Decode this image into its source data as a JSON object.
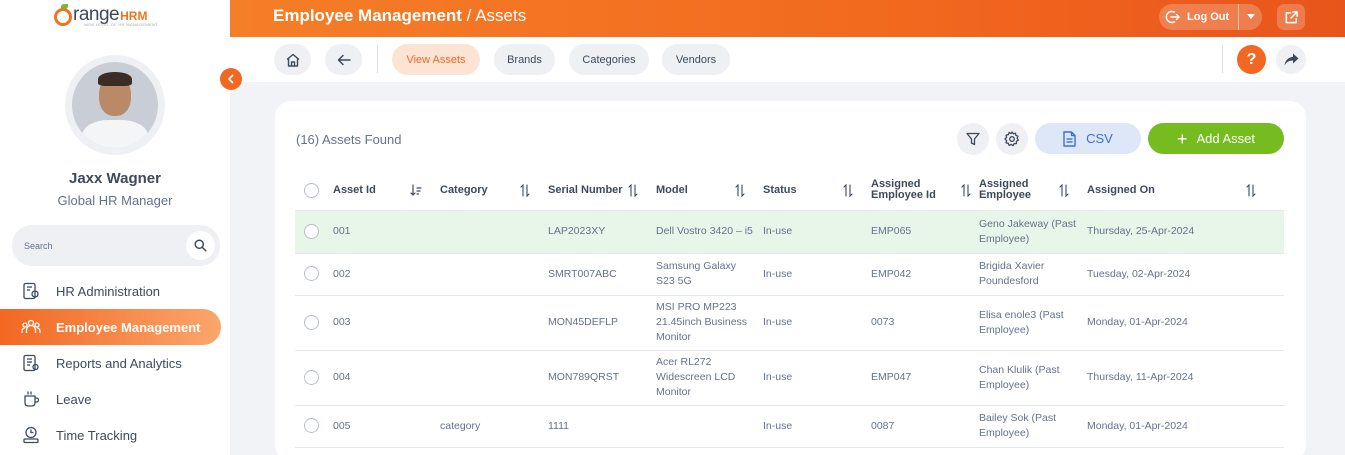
{
  "brand": {
    "name": "range",
    "suffix": "HRM",
    "tagline": "NEW LEVEL OF HR MANAGEMENT"
  },
  "user": {
    "name": "Jaxx Wagner",
    "role": "Global HR Manager"
  },
  "sidebar": {
    "search_placeholder": "Search",
    "items": [
      {
        "label": "HR Administration",
        "icon": "hr-admin-icon"
      },
      {
        "label": "Employee Management",
        "icon": "employee-management-icon",
        "active": true
      },
      {
        "label": "Reports and Analytics",
        "icon": "reports-icon"
      },
      {
        "label": "Leave",
        "icon": "leave-icon"
      },
      {
        "label": "Time Tracking",
        "icon": "time-tracking-icon"
      }
    ]
  },
  "header": {
    "title": "Employee Management",
    "separator": " / ",
    "subtitle": "Assets",
    "logout_label": "Log Out"
  },
  "subnav": {
    "tabs": [
      {
        "label": "View Assets",
        "active": true
      },
      {
        "label": "Brands"
      },
      {
        "label": "Categories"
      },
      {
        "label": "Vendors"
      }
    ],
    "help_label": "?"
  },
  "assets": {
    "found_text": "(16) Assets Found",
    "csv_label": "CSV",
    "add_label": "Add Asset",
    "columns": [
      "Asset Id",
      "Category",
      "Serial Number",
      "Model",
      "Status",
      "Assigned Employee Id",
      "Assigned Employee",
      "Assigned On"
    ],
    "rows": [
      {
        "id": "001",
        "category": "",
        "serial": "LAP2023XY",
        "model": "Dell Vostro 3420 – i5",
        "status": "In-use",
        "emp_id": "EMP065",
        "employee": "Geno Jakeway (Past Employee)",
        "assigned_on": "Thursday, 25-Apr-2024"
      },
      {
        "id": "002",
        "category": "",
        "serial": "SMRT007ABC",
        "model": "Samsung Galaxy S23 5G",
        "status": "In-use",
        "emp_id": "EMP042",
        "employee": "Brigida Xavier Poundesford",
        "assigned_on": "Tuesday, 02-Apr-2024"
      },
      {
        "id": "003",
        "category": "",
        "serial": "MON45DEFLP",
        "model": "MSI PRO MP223 21.45inch Business Monitor",
        "status": "In-use",
        "emp_id": "0073",
        "employee": "Elisa enole3 (Past Employee)",
        "assigned_on": "Monday, 01-Apr-2024"
      },
      {
        "id": "004",
        "category": "",
        "serial": "MON789QRST",
        "model": "Acer RL272 Widescreen LCD Monitor",
        "status": "In-use",
        "emp_id": "EMP047",
        "employee": "Chan Klulik (Past Employee)",
        "assigned_on": "Thursday, 11-Apr-2024"
      },
      {
        "id": "005",
        "category": "category",
        "serial": "1111",
        "model": "",
        "status": "In-use",
        "emp_id": "0087",
        "employee": "Bailey Sok (Past Employee)",
        "assigned_on": "Monday, 01-Apr-2024"
      }
    ]
  },
  "colors": {
    "accent": "#f26722",
    "green": "#76bc21",
    "highlight_row": "#e8f5e9"
  }
}
